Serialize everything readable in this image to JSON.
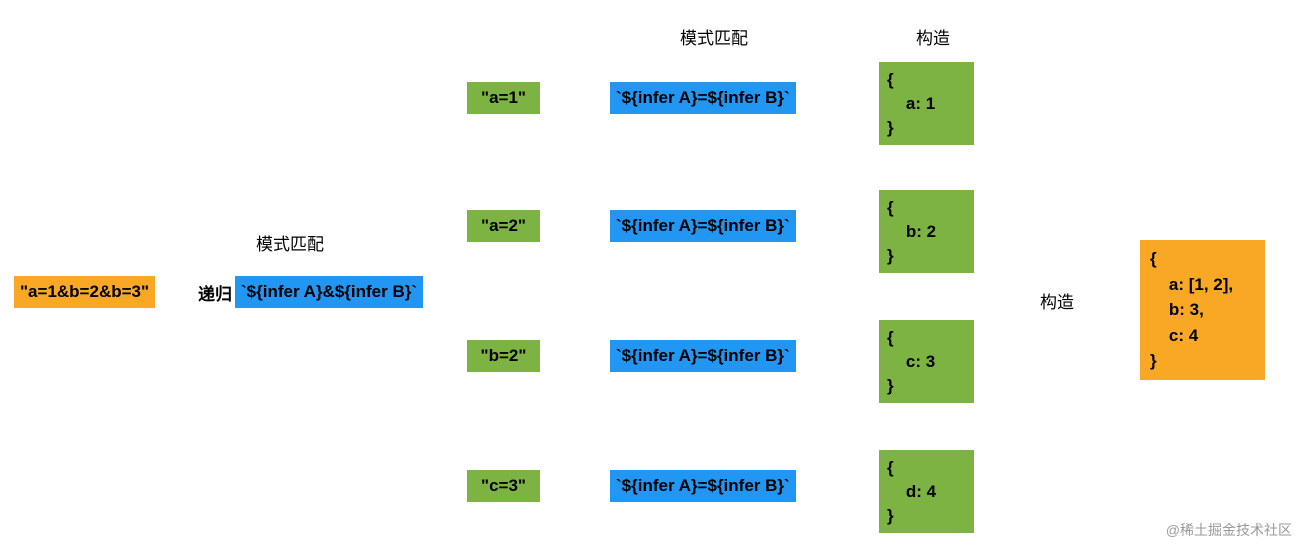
{
  "input": {
    "label": "\"a=1&b=2&b=3\""
  },
  "recursion": {
    "header": "模式匹配",
    "prefix": "递归",
    "pattern": "`${infer A}&${infer B}`"
  },
  "middle": {
    "header": "模式匹配",
    "result_header": "构造",
    "pattern": "`${infer A}=${infer B}`",
    "rows": [
      {
        "token": "\"a=1\"",
        "result": "{\n    a: 1\n}"
      },
      {
        "token": "\"a=2\"",
        "result": "{\n    b: 2\n}"
      },
      {
        "token": "\"b=2\"",
        "result": "{\n    c: 3\n}"
      },
      {
        "token": "\"c=3\"",
        "result": "{\n    d: 4\n}"
      }
    ]
  },
  "final": {
    "header": "构造",
    "result": "{\n    a: [1, 2],\n    b: 3,\n    c: 4\n}"
  },
  "watermark": "@稀土掘金技术社区"
}
